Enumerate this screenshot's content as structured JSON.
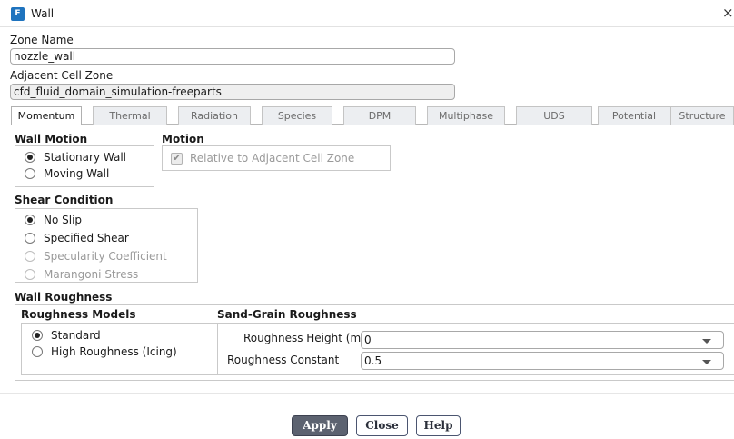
{
  "window": {
    "icon_letter": "F",
    "title": "Wall",
    "close_glyph": "×"
  },
  "zone": {
    "name_label": "Zone Name",
    "name_value": "nozzle_wall",
    "adjacent_label": "Adjacent Cell Zone",
    "adjacent_value": "cfd_fluid_domain_simulation-freeparts"
  },
  "tabs": [
    "Momentum",
    "Thermal",
    "Radiation",
    "Species",
    "DPM",
    "Multiphase",
    "UDS",
    "Potential",
    "Structure"
  ],
  "active_tab": "Momentum",
  "wall_motion": {
    "title": "Wall Motion",
    "options": [
      "Stationary Wall",
      "Moving Wall"
    ],
    "selected": "Stationary Wall"
  },
  "motion": {
    "title": "Motion",
    "checkbox_label": "Relative to Adjacent Cell Zone",
    "checked": true,
    "disabled": true
  },
  "shear": {
    "title": "Shear Condition",
    "options": [
      "No Slip",
      "Specified Shear",
      "Specularity Coefficient",
      "Marangoni Stress"
    ],
    "selected": "No Slip"
  },
  "roughness": {
    "title": "Wall Roughness",
    "models_title": "Roughness Models",
    "models": [
      "Standard",
      "High Roughness (Icing)"
    ],
    "selected": "Standard",
    "sand_title": "Sand-Grain Roughness",
    "height_label": "Roughness Height (m)",
    "height_value": "0",
    "constant_label": "Roughness Constant",
    "constant_value": "0.5"
  },
  "buttons": {
    "apply": "Apply",
    "close": "Close",
    "help": "Help"
  },
  "colors": {
    "accent": "#1e73be",
    "primary_button": "#5c6270"
  }
}
